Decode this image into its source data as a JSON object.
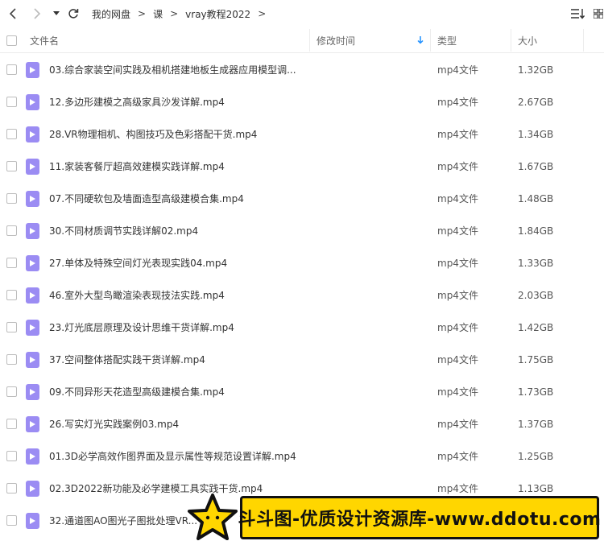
{
  "toolbar": {
    "breadcrumb": [
      "我的网盘",
      "课",
      "vray教程2022"
    ],
    "separator": ">"
  },
  "columns": {
    "name": "文件名",
    "modified": "修改时间",
    "type": "类型",
    "size": "大小"
  },
  "files": [
    {
      "name": "03.综合家装空间实践及相机搭建地板生成器应用模型调...",
      "type": "mp4文件",
      "size": "1.32GB"
    },
    {
      "name": "12.多边形建模之高级家具沙发详解.mp4",
      "type": "mp4文件",
      "size": "2.67GB"
    },
    {
      "name": "28.VR物理相机、构图技巧及色彩搭配干货.mp4",
      "type": "mp4文件",
      "size": "1.34GB"
    },
    {
      "name": "11.家装客餐厅超高效建模实践详解.mp4",
      "type": "mp4文件",
      "size": "1.67GB"
    },
    {
      "name": "07.不同硬软包及墙面造型高级建模合集.mp4",
      "type": "mp4文件",
      "size": "1.48GB"
    },
    {
      "name": "30.不同材质调节实践详解02.mp4",
      "type": "mp4文件",
      "size": "1.84GB"
    },
    {
      "name": "27.单体及特殊空间灯光表现实践04.mp4",
      "type": "mp4文件",
      "size": "1.33GB"
    },
    {
      "name": "46.室外大型鸟瞰渲染表现技法实践.mp4",
      "type": "mp4文件",
      "size": "2.03GB"
    },
    {
      "name": "23.灯光底层原理及设计思维干货详解.mp4",
      "type": "mp4文件",
      "size": "1.42GB"
    },
    {
      "name": "37.空间整体搭配实践干货详解.mp4",
      "type": "mp4文件",
      "size": "1.75GB"
    },
    {
      "name": "09.不同异形天花造型高级建模合集.mp4",
      "type": "mp4文件",
      "size": "1.73GB"
    },
    {
      "name": "26.写实灯光实践案例03.mp4",
      "type": "mp4文件",
      "size": "1.37GB"
    },
    {
      "name": "01.3D必学高效作图界面及显示属性等规范设置详解.mp4",
      "type": "mp4文件",
      "size": "1.25GB"
    },
    {
      "name": "02.3D2022新功能及必学建模工具实践干货.mp4",
      "type": "mp4文件",
      "size": "1.13GB"
    },
    {
      "name": "32.通道图AO图光子图批处理VR...",
      "type": "",
      "size": ""
    }
  ],
  "watermark": {
    "text": "斗斗图-优质设计资源库-www.ddotu.com"
  },
  "colors": {
    "file_icon": "#9b8cf3",
    "sort_arrow": "#1e90ff",
    "banner": "#ffd600"
  },
  "icons": {
    "back": "chevron-left-icon",
    "forward": "chevron-right-icon",
    "history": "caret-down-icon",
    "refresh": "refresh-icon",
    "view": "sort-list-icon",
    "more": "grid-icon",
    "file": "video-file-icon",
    "sort": "arrow-down-icon",
    "watermark": "star-icon"
  }
}
